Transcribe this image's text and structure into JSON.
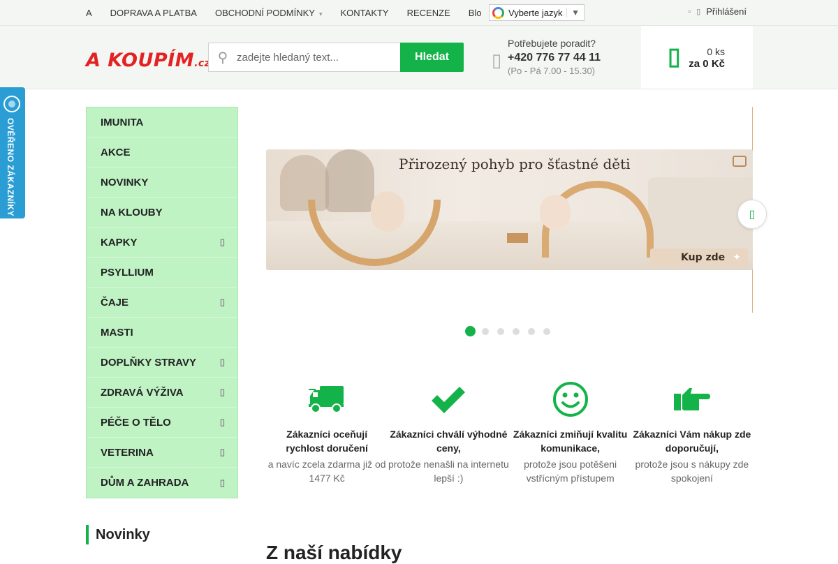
{
  "topbar": {
    "nav": [
      {
        "label": "A",
        "has_dropdown": false
      },
      {
        "label": "DOPRAVA A PLATBA",
        "has_dropdown": false
      },
      {
        "label": "OBCHODNÍ PODMÍNKY",
        "has_dropdown": true
      },
      {
        "label": "KONTAKTY",
        "has_dropdown": false
      },
      {
        "label": "RECENZE",
        "has_dropdown": false
      },
      {
        "label": "Blo",
        "has_dropdown": false
      }
    ],
    "language_label": "Vyberte jazyk",
    "login_label": "Přihlášení"
  },
  "header": {
    "logo_text": "A KOUPÍM",
    "logo_suffix": ".cz",
    "search_placeholder": "zadejte hledaný text...",
    "search_button": "Hledat",
    "advice_label": "Potřebujete poradit?",
    "phone": "+420 776 77 44 11",
    "hours": "(Po - Pá 7.00 - 15.30)",
    "cart_qty": "0 ks",
    "cart_sum": "za 0 Kč"
  },
  "side_badge": {
    "label": "OVĚŘENO ZÁKAZNÍKY"
  },
  "menu": {
    "items": [
      {
        "label": "IMUNITA",
        "has_sub": false
      },
      {
        "label": "AKCE",
        "has_sub": false
      },
      {
        "label": "NOVINKY",
        "has_sub": false
      },
      {
        "label": "NA KLOUBY",
        "has_sub": false
      },
      {
        "label": "KAPKY",
        "has_sub": true
      },
      {
        "label": "PSYLLIUM",
        "has_sub": false
      },
      {
        "label": "ČAJE",
        "has_sub": true
      },
      {
        "label": "MASTI",
        "has_sub": false
      },
      {
        "label": "DOPLŇKY STRAVY",
        "has_sub": true
      },
      {
        "label": "ZDRAVÁ VÝŽIVA",
        "has_sub": true
      },
      {
        "label": "PÉČE O TĚLO",
        "has_sub": true
      },
      {
        "label": "VETERINA",
        "has_sub": true
      },
      {
        "label": "DŮM A ZAHRADA",
        "has_sub": true
      }
    ]
  },
  "banner": {
    "headline": "Přirozený pohyb pro šťastné děti",
    "cta": "Kup zde",
    "dots_count": 6,
    "active_dot": 1
  },
  "benefits": [
    {
      "icon": "delivery-truck-icon",
      "title": "Zákazníci oceňují rychlost doručení",
      "desc": "a navíc zcela zdarma již od 1477 Kč"
    },
    {
      "icon": "checkmark-icon",
      "title": "Zákazníci chválí výhodné ceny,",
      "desc": "protože nenašli na internetu lepší :)"
    },
    {
      "icon": "smiley-icon",
      "title": "Zákazníci zmiňují kvalitu komunikace,",
      "desc": "protože jsou potěšeni vstřícným přístupem"
    },
    {
      "icon": "thumbs-hand-icon",
      "title": "Zákazníci Vám nákup zde doporučují,",
      "desc": "protože jsou s nákupy zde spokojení"
    }
  ],
  "sections": {
    "left_title": "Novinky",
    "main_title": "Z naší nabídky"
  },
  "colors": {
    "accent": "#13b34a",
    "menu_bg": "#bff3c4",
    "logo_red": "#e32323",
    "badge_blue": "#2a9ed4"
  }
}
